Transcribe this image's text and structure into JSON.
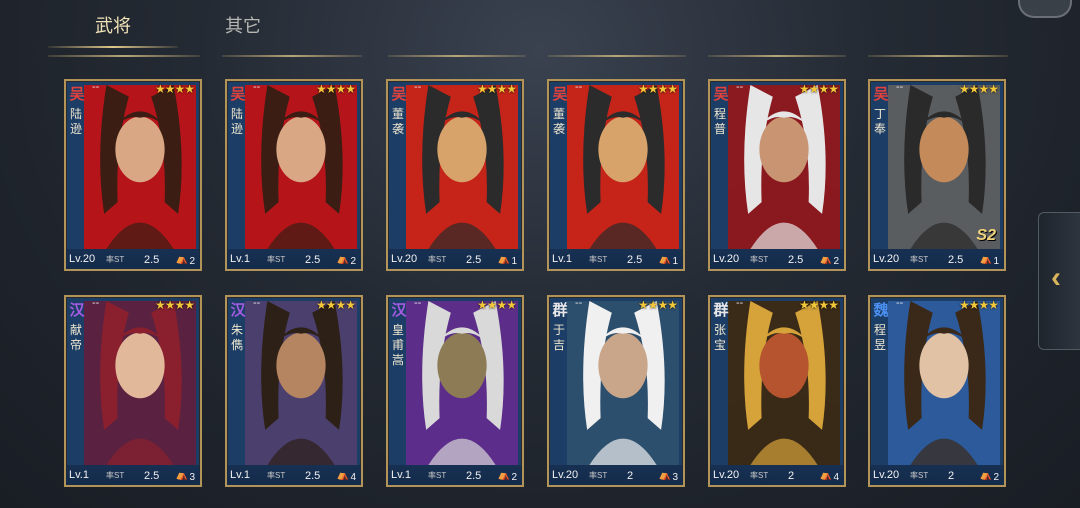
{
  "tabs": [
    {
      "label": "武将",
      "active": true
    },
    {
      "label": "其它",
      "active": false
    }
  ],
  "side_tab_icon": "chevron-left-icon",
  "faction_colors": {
    "吴": "#e0423c",
    "汉": "#a45be0",
    "群": "#e8e8e8",
    "魏": "#4b8ff0"
  },
  "cards": [
    {
      "faction": "吴",
      "dash": "--",
      "stars": "★★★★",
      "name": "陆逊",
      "level": "Lv.20",
      "stat_label": "率ST",
      "cost": "2.5",
      "count": "2",
      "badge": "",
      "palette": [
        "#b5151a",
        "#3b1d14",
        "#d9a784"
      ]
    },
    {
      "faction": "吴",
      "dash": "--",
      "stars": "★★★★",
      "name": "陆逊",
      "level": "Lv.1",
      "stat_label": "率ST",
      "cost": "2.5",
      "count": "2",
      "badge": "",
      "palette": [
        "#b5151a",
        "#3b1d14",
        "#d9a784"
      ]
    },
    {
      "faction": "吴",
      "dash": "--",
      "stars": "★★★★",
      "name": "董袭",
      "level": "Lv.20",
      "stat_label": "率ST",
      "cost": "2.5",
      "count": "1",
      "badge": "",
      "palette": [
        "#c52419",
        "#2b2b2b",
        "#d8a36b"
      ]
    },
    {
      "faction": "吴",
      "dash": "--",
      "stars": "★★★★",
      "name": "董袭",
      "level": "Lv.1",
      "stat_label": "率ST",
      "cost": "2.5",
      "count": "1",
      "badge": "",
      "palette": [
        "#c52419",
        "#2b2b2b",
        "#d8a36b"
      ]
    },
    {
      "faction": "吴",
      "dash": "--",
      "stars": "★★★★",
      "name": "程普",
      "level": "Lv.20",
      "stat_label": "率ST",
      "cost": "2.5",
      "count": "2",
      "badge": "",
      "palette": [
        "#8a1a1f",
        "#e6e6e6",
        "#c99472"
      ]
    },
    {
      "faction": "吴",
      "dash": "--",
      "stars": "★★★★",
      "name": "丁奉",
      "level": "Lv.20",
      "stat_label": "率ST",
      "cost": "2.5",
      "count": "1",
      "badge": "S2",
      "palette": [
        "#5a5d60",
        "#2a2a2a",
        "#c48a5a"
      ]
    },
    {
      "faction": "汉",
      "dash": "--",
      "stars": "★★★★",
      "name": "献帝",
      "level": "Lv.1",
      "stat_label": "率ST",
      "cost": "2.5",
      "count": "3",
      "badge": "",
      "palette": [
        "#5a2240",
        "#8a1f2e",
        "#e2b89a"
      ]
    },
    {
      "faction": "汉",
      "dash": "--",
      "stars": "★★★★",
      "name": "朱儁",
      "level": "Lv.1",
      "stat_label": "率ST",
      "cost": "2.5",
      "count": "4",
      "badge": "",
      "palette": [
        "#4b3f6e",
        "#2d2016",
        "#b58461"
      ]
    },
    {
      "faction": "汉",
      "dash": "--",
      "stars": "★★★★",
      "name": "皇甫嵩",
      "level": "Lv.1",
      "stat_label": "率ST",
      "cost": "2.5",
      "count": "2",
      "badge": "",
      "palette": [
        "#5c2e8a",
        "#d9d9d9",
        "#8d7b56"
      ]
    },
    {
      "faction": "群",
      "dash": "--",
      "stars": "★★★★",
      "name": "于吉",
      "level": "Lv.20",
      "stat_label": "率ST",
      "cost": "2",
      "count": "3",
      "badge": "",
      "palette": [
        "#2d4f6e",
        "#f0f0f0",
        "#c9a58a"
      ]
    },
    {
      "faction": "群",
      "dash": "--",
      "stars": "★★★★",
      "name": "张宝",
      "level": "Lv.20",
      "stat_label": "率ST",
      "cost": "2",
      "count": "4",
      "badge": "",
      "palette": [
        "#3a2a18",
        "#d6a33a",
        "#b5542e"
      ]
    },
    {
      "faction": "魏",
      "dash": "--",
      "stars": "★★★★",
      "name": "程昱",
      "level": "Lv.20",
      "stat_label": "率ST",
      "cost": "2",
      "count": "2",
      "badge": "",
      "palette": [
        "#2c5a9a",
        "#3a2818",
        "#e2c2a4"
      ]
    }
  ]
}
